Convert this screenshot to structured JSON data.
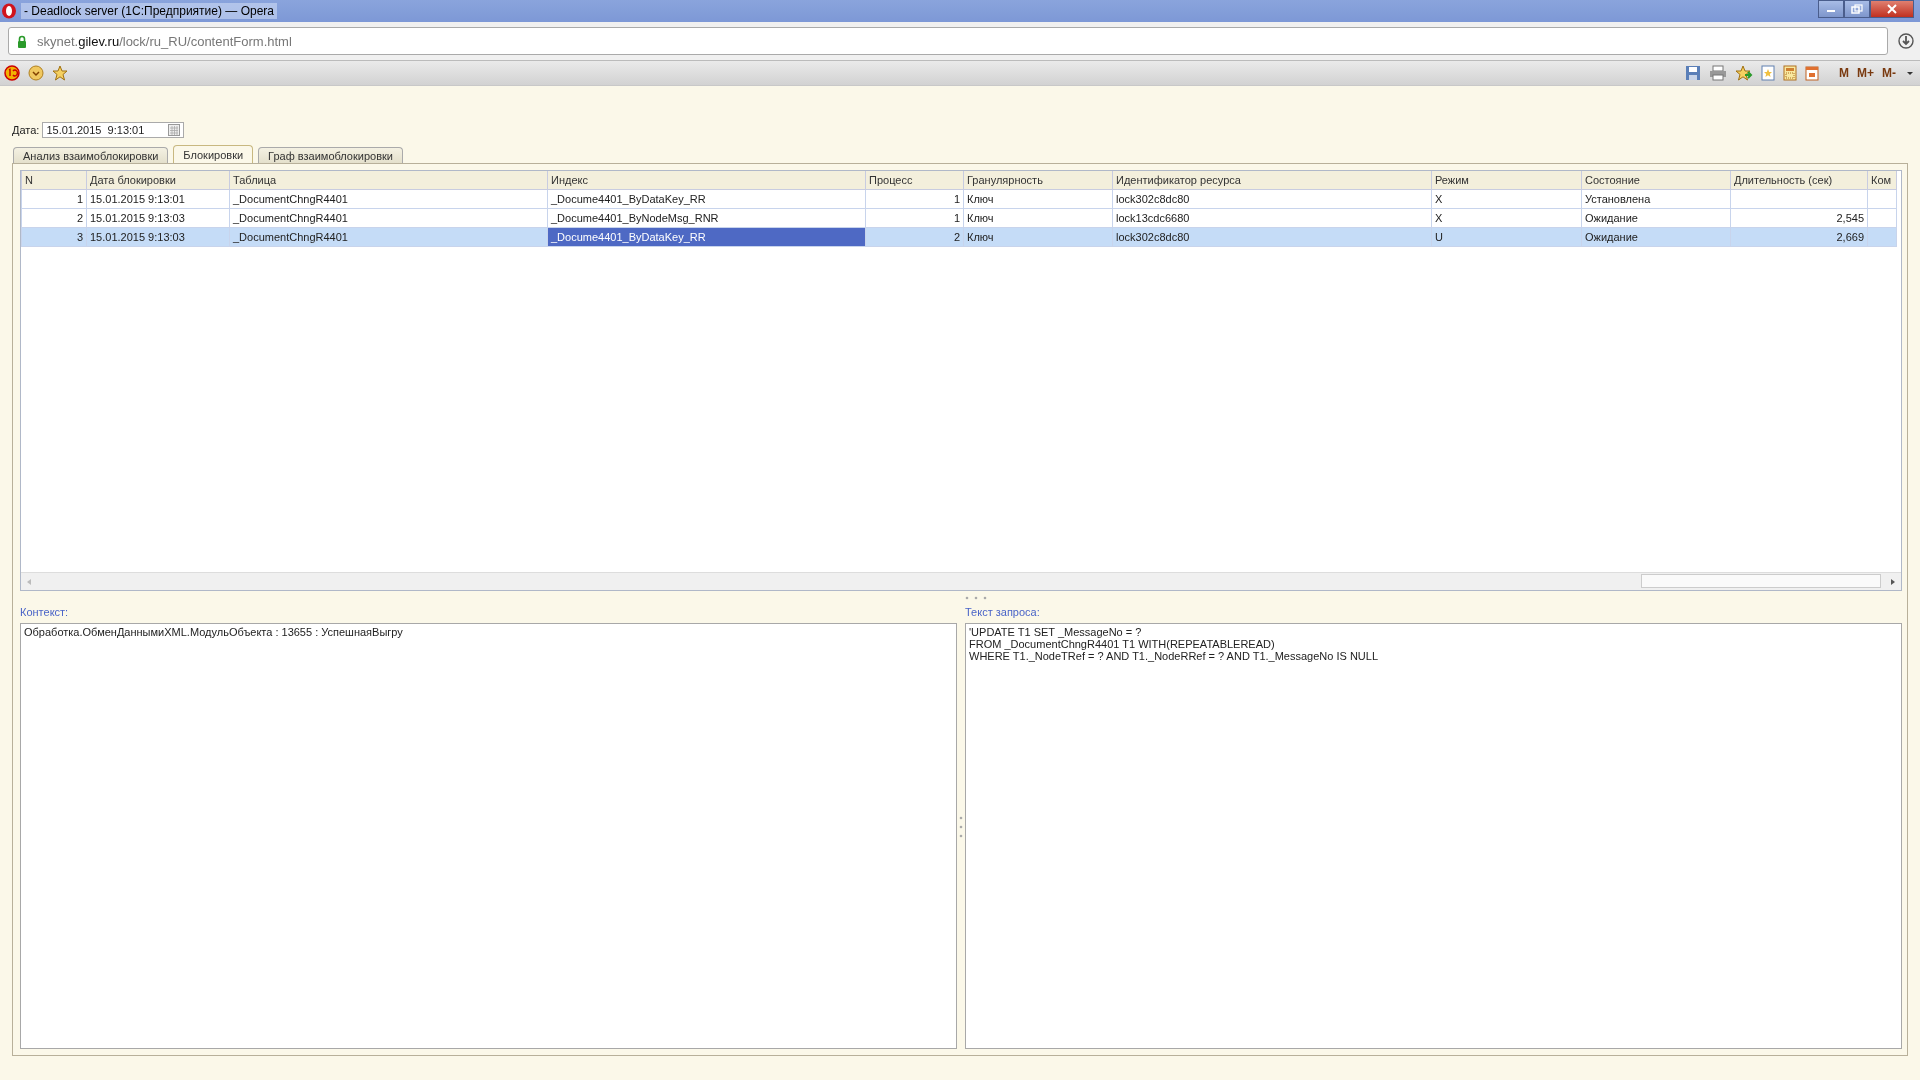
{
  "window": {
    "title": "- Deadlock server (1С:Предприятие) — Opera"
  },
  "address_bar": {
    "host_prefix": "skynet.",
    "host_domain": "gilev.ru",
    "path": "/lock/ru_RU/contentForm.html"
  },
  "toolbar": {
    "memory_buttons": [
      "M",
      "M+",
      "M-"
    ]
  },
  "date_field": {
    "label": "Дата:",
    "value": "15.01.2015  9:13:01"
  },
  "tabs": [
    {
      "label": "Анализ взаимоблокировки",
      "selected": false
    },
    {
      "label": "Блокировки",
      "selected": true
    },
    {
      "label": "Граф взаимоблокировки",
      "selected": false
    }
  ],
  "table": {
    "columns": [
      {
        "label": "N",
        "kind": "number"
      },
      {
        "label": "Дата блокировки",
        "kind": "text"
      },
      {
        "label": "Таблица",
        "kind": "text"
      },
      {
        "label": "Индекс",
        "kind": "text"
      },
      {
        "label": "Процесс",
        "kind": "number"
      },
      {
        "label": "Гранулярность",
        "kind": "text"
      },
      {
        "label": "Идентификатор ресурса",
        "kind": "text"
      },
      {
        "label": "Режим",
        "kind": "text"
      },
      {
        "label": "Состояние",
        "kind": "text"
      },
      {
        "label": "Длительность (сек)",
        "kind": "number"
      },
      {
        "label": "Ком",
        "kind": "text"
      }
    ],
    "rows": [
      {
        "selected": false,
        "cells": [
          {
            "text": "1",
            "focused": false
          },
          {
            "text": "15.01.2015 9:13:01",
            "focused": false
          },
          {
            "text": "_DocumentChngR4401",
            "focused": false
          },
          {
            "text": "_Docume4401_ByDataKey_RR",
            "focused": false
          },
          {
            "text": "1",
            "focused": false
          },
          {
            "text": "Ключ",
            "focused": false
          },
          {
            "text": "lock302c8dc80",
            "focused": false
          },
          {
            "text": "X",
            "focused": false
          },
          {
            "text": "Установлена",
            "focused": false
          },
          {
            "text": "",
            "focused": false
          },
          {
            "text": "",
            "focused": false
          }
        ]
      },
      {
        "selected": false,
        "cells": [
          {
            "text": "2",
            "focused": false
          },
          {
            "text": "15.01.2015 9:13:03",
            "focused": false
          },
          {
            "text": "_DocumentChngR4401",
            "focused": false
          },
          {
            "text": "_Docume4401_ByNodeMsg_RNR",
            "focused": false
          },
          {
            "text": "1",
            "focused": false
          },
          {
            "text": "Ключ",
            "focused": false
          },
          {
            "text": "lock13cdc6680",
            "focused": false
          },
          {
            "text": "X",
            "focused": false
          },
          {
            "text": "Ожидание",
            "focused": false
          },
          {
            "text": "2,545",
            "focused": false
          },
          {
            "text": "",
            "focused": false
          }
        ]
      },
      {
        "selected": true,
        "cells": [
          {
            "text": "3",
            "focused": false
          },
          {
            "text": "15.01.2015 9:13:03",
            "focused": false
          },
          {
            "text": "_DocumentChngR4401",
            "focused": false
          },
          {
            "text": "_Docume4401_ByDataKey_RR",
            "focused": true
          },
          {
            "text": "2",
            "focused": false
          },
          {
            "text": "Ключ",
            "focused": false
          },
          {
            "text": "lock302c8dc80",
            "focused": false
          },
          {
            "text": "U",
            "focused": false
          },
          {
            "text": "Ожидание",
            "focused": false
          },
          {
            "text": "2,669",
            "focused": false
          },
          {
            "text": "",
            "focused": false
          }
        ]
      }
    ]
  },
  "context_pane": {
    "label": "Контекст:",
    "text": "Обработка.ОбменДаннымиXML.МодульОбъекта : 13655 : УспешнаяВыгру"
  },
  "query_pane": {
    "label": "Текст запроса:",
    "text": "'UPDATE T1 SET _MessageNo = ?\nFROM _DocumentChngR4401 T1 WITH(REPEATABLEREAD)\nWHERE T1._NodeTRef = ? AND T1._NodeRRef = ? AND T1._MessageNo IS NULL"
  }
}
